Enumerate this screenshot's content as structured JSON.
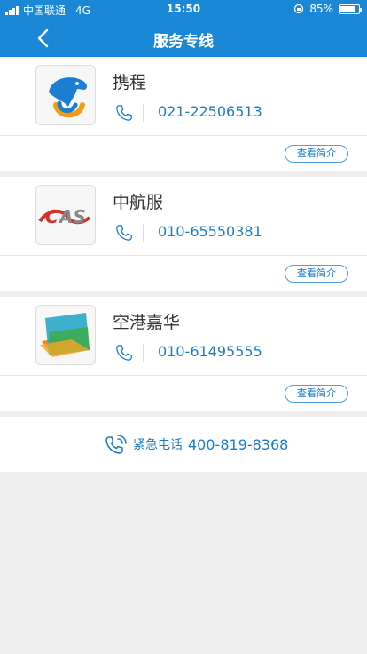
{
  "status_bar": {
    "carrier": "中国联通",
    "network": "4G",
    "time": "15:50",
    "battery": "85%",
    "battery_level": 0.85
  },
  "header": {
    "title": "服务专线",
    "back_icon": "chevron-left-icon"
  },
  "services": [
    {
      "name": "携程",
      "phone": "021-22506513",
      "intro_label": "查看简介",
      "logo": "ctrip-dolphin-logo"
    },
    {
      "name": "中航服",
      "phone": "010-65550381",
      "intro_label": "查看简介",
      "logo": "cas-logo"
    },
    {
      "name": "空港嘉华",
      "phone": "010-61495555",
      "intro_label": "查看简介",
      "logo": "airport-jiahua-logo"
    }
  ],
  "emergency": {
    "label": "紧急电话",
    "phone": "400-819-8368",
    "icon": "phone-ringing-icon"
  },
  "colors": {
    "header_bg": "#1a88d6",
    "accent": "#1a7ccc",
    "page_bg": "#eeeeee"
  }
}
